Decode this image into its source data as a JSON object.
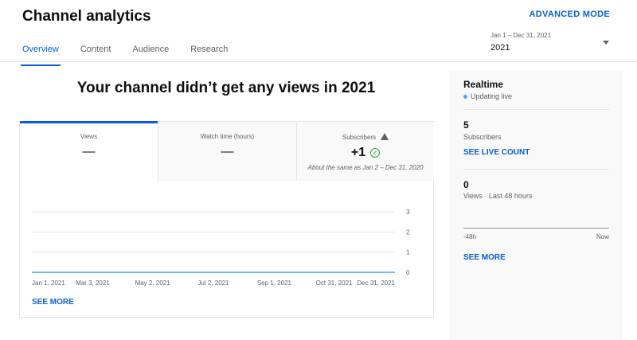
{
  "header": {
    "title": "Channel analytics",
    "advanced_mode": "ADVANCED MODE"
  },
  "tabs": [
    {
      "label": "Overview",
      "active": true
    },
    {
      "label": "Content",
      "active": false
    },
    {
      "label": "Audience",
      "active": false
    },
    {
      "label": "Research",
      "active": false
    }
  ],
  "date_picker": {
    "range": "Jan 1 – Dec 31, 2021",
    "value": "2021"
  },
  "headline": "Your channel didn’t get any views in 2021",
  "metrics": [
    {
      "label": "Views",
      "value": "—"
    },
    {
      "label": "Watch time (hours)",
      "value": "—"
    },
    {
      "label": "Subscribers",
      "value": "+1",
      "note": "About the same as Jan 2 – Dec 31, 2020"
    }
  ],
  "chart_data": {
    "type": "line",
    "x": [
      "Jan 1, 2021",
      "Mar 3, 2021",
      "May 2, 2021",
      "Jul 2, 2021",
      "Sep 1, 2021",
      "Oct 31, 2021",
      "Dec 31, 2021"
    ],
    "x_ticks": [
      "Jan 1, 2021",
      "Mar 3, 2021",
      "May 2, 2021",
      "Jul 2, 2021",
      "Sep 1, 2021",
      "Oct 31, 2021",
      "Dec 31, 2021"
    ],
    "y_ticks": [
      "0",
      "1",
      "2",
      "3"
    ],
    "values": [
      0,
      0,
      0,
      0,
      0,
      0,
      0
    ],
    "ylim": [
      0,
      3
    ],
    "grid": true,
    "line_color": "#3ea6ff"
  },
  "see_more": "SEE MORE",
  "realtime": {
    "title": "Realtime",
    "status": "Updating live",
    "subscribers_count": "5",
    "subscribers_label": "Subscribers",
    "see_live_count": "SEE LIVE COUNT",
    "views_count": "0",
    "views_label": "Views · Last 48 hours",
    "axis_start": "-48h",
    "axis_end": "Now",
    "see_more": "SEE MORE"
  },
  "colors": {
    "accent": "#065fd4",
    "success": "#2ba640",
    "live": "#3ea6ff"
  }
}
